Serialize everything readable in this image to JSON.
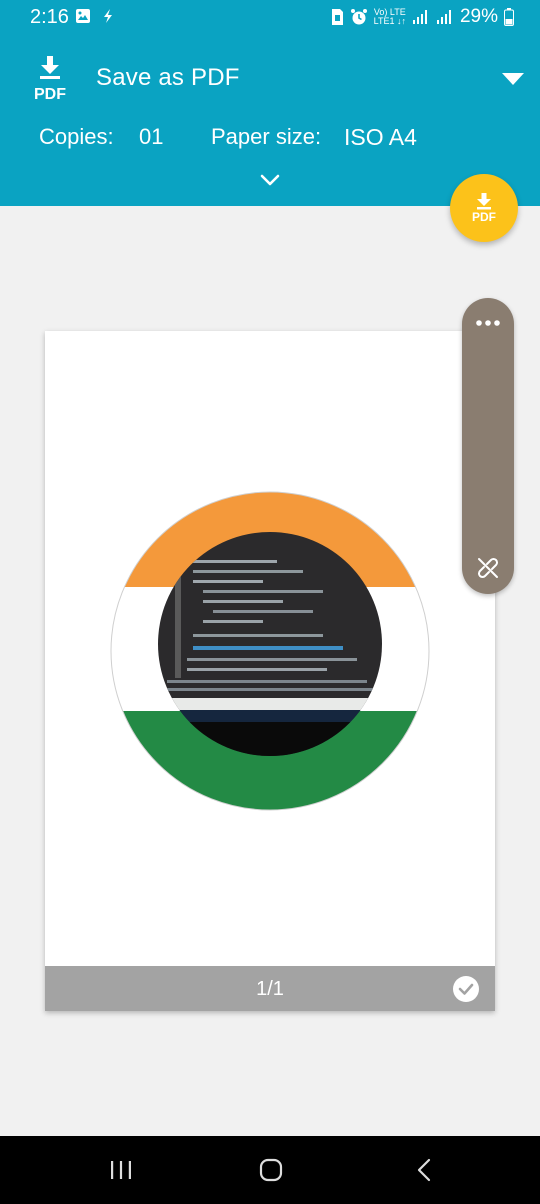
{
  "status_bar": {
    "time": "2:16",
    "lte_top": "Vo) LTE",
    "lte_bottom": "LTE1 ↓↑",
    "battery": "29%"
  },
  "header": {
    "logo_text": "PDF",
    "printer_name": "Save as PDF",
    "copies_label": "Copies:",
    "copies_value": "01",
    "paper_size_label": "Paper size:",
    "paper_size_value": "ISO A4"
  },
  "fab": {
    "label": "PDF"
  },
  "preview": {
    "page_number": "1/1"
  },
  "colors": {
    "header_bg": "#0aa3c2",
    "fab_bg": "#fcc21a",
    "saffron": "#f4993b",
    "green": "#238a45",
    "footer_bg": "#a3a3a3",
    "side_panel_bg": "#8a7d70"
  },
  "icons": {
    "status_left": [
      "gallery-icon",
      "flash-icon"
    ],
    "status_right": [
      "sim-icon",
      "alarm-icon",
      "signal-icon",
      "signal-icon",
      "battery-icon"
    ],
    "nav": [
      "recents-icon",
      "home-icon",
      "back-icon"
    ]
  }
}
